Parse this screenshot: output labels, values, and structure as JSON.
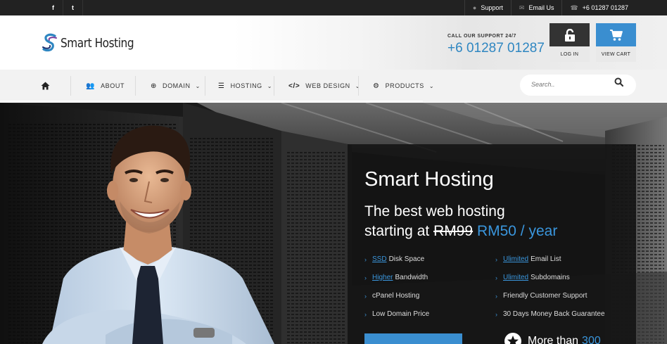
{
  "topbar": {
    "social": [
      {
        "icon": "facebook-icon",
        "glyph": "f"
      },
      {
        "icon": "twitter-icon",
        "glyph": "t"
      }
    ],
    "support_label": "Support",
    "email_label": "Email Us",
    "phone_label": "+6 01287 01287"
  },
  "header": {
    "brand_name": "Smart Hosting",
    "call_label": "CALL OUR SUPPORT 24/7",
    "call_number": "+6 01287 01287",
    "login_label": "LOG IN",
    "cart_label": "VIEW CART"
  },
  "nav": {
    "home_icon": "home-icon",
    "items": [
      {
        "label": "ABOUT",
        "icon": "users-icon"
      },
      {
        "label": "DOMAIN",
        "icon": "globe-icon"
      },
      {
        "label": "HOSTING",
        "icon": "server-icon"
      },
      {
        "label": "WEB DESIGN",
        "icon": "code-icon"
      },
      {
        "label": "PRODUCTS",
        "icon": "cogs-icon"
      }
    ],
    "search_placeholder": "Search.."
  },
  "hero": {
    "title": "Smart Hosting",
    "subtitle_line1": "The best web hosting",
    "subtitle_prefix": "starting at",
    "old_price": "RM99",
    "new_price": "RM50 / year",
    "features_left": [
      {
        "highlight": "SSD",
        "text": "Disk Space"
      },
      {
        "highlight": "Higher",
        "text": "Bandwidth"
      },
      {
        "highlight": "",
        "text": "cPanel Hosting"
      },
      {
        "highlight": "",
        "text": "Low Domain Price"
      }
    ],
    "features_right": [
      {
        "highlight": "Ulimited",
        "text": "Email List"
      },
      {
        "highlight": "Ulimited",
        "text": "Subdomains"
      },
      {
        "highlight": "",
        "text": "Friendly Customer Support"
      },
      {
        "highlight": "",
        "text": "30 Days Money Back Guarantee"
      }
    ],
    "more_prefix": "More than",
    "more_count": "300"
  },
  "colors": {
    "accent": "#3a8ed0",
    "topbar": "#222222",
    "nav_bg": "#f2f2f2",
    "panel": "#141414"
  }
}
